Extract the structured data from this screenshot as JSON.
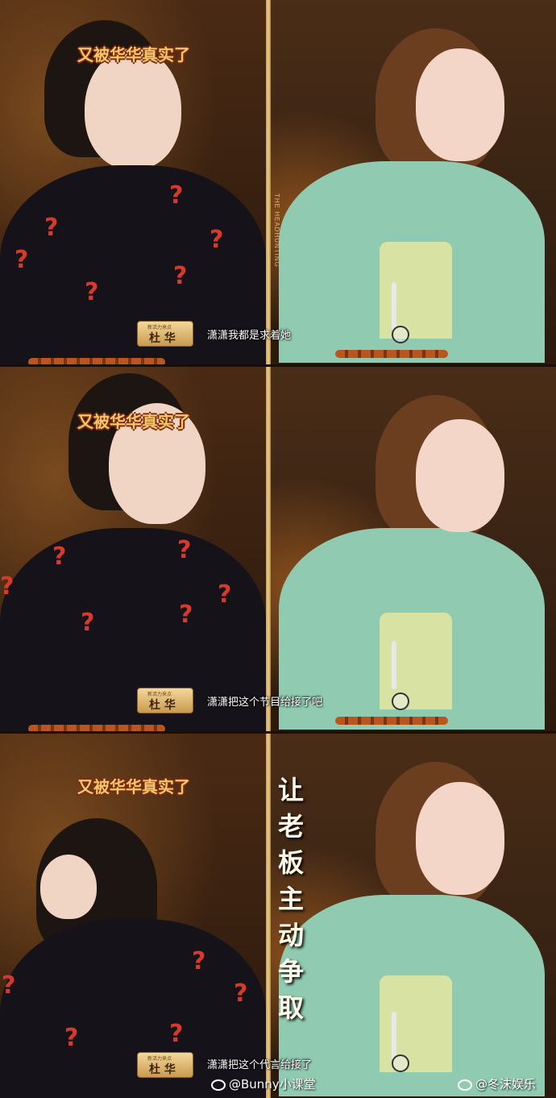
{
  "panels": [
    {
      "caption": "又被华华真实了",
      "name_tag_small": "新活力来点",
      "speaker": "杜 华",
      "subtitle": "潇潇我都是求着她"
    },
    {
      "caption": "又被华华真实了",
      "name_tag_small": "新活力来点",
      "speaker": "杜 华",
      "subtitle": "潇潇把这个节目给接了吧"
    },
    {
      "caption": "又被华华真实了",
      "name_tag_small": "新活力来点",
      "speaker": "杜 华",
      "subtitle": "潇潇把这个代言给接了"
    }
  ],
  "show_vertical_text": "THE HEADHUNTING",
  "vertical_caption": [
    "让",
    "老",
    "板",
    "主",
    "动",
    "争",
    "取"
  ],
  "watermarks": {
    "left": "@Bunny小课堂",
    "right": "@冬沫娱乐"
  },
  "icons": [
    "weibo-icon",
    "microphone-icon",
    "crosshair-icon"
  ],
  "colors": {
    "caption_text": "#f6c66a",
    "caption_outline": "#7a2d10",
    "divider_gold": "#e8cf8e",
    "jacket_green": "#8fcab1"
  }
}
